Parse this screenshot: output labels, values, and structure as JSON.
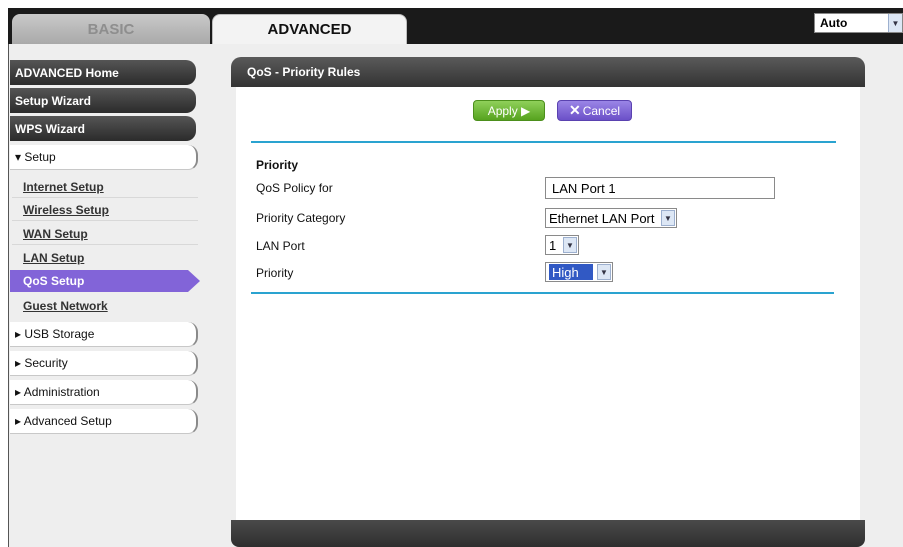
{
  "tabs": {
    "basic": "BASIC",
    "advanced": "ADVANCED"
  },
  "language_select": {
    "value": "Auto"
  },
  "sidebar": {
    "advanced_home": "ADVANCED Home",
    "setup_wizard": "Setup Wizard",
    "wps_wizard": "WPS Wizard",
    "setup": "▾ Setup",
    "setup_items": [
      "Internet Setup",
      "Wireless Setup",
      "WAN Setup",
      "LAN Setup",
      "QoS Setup",
      "Guest Network"
    ],
    "usb_storage": "▸ USB Storage",
    "security": "▸ Security",
    "administration": "▸ Administration",
    "advanced_setup": "▸ Advanced Setup"
  },
  "panel": {
    "title": "QoS - Priority Rules",
    "apply_label": "Apply ▶",
    "cancel_label": "Cancel",
    "section_title": "Priority",
    "fields": {
      "policy_label": "QoS Policy for",
      "policy_value": "LAN Port 1",
      "category_label": "Priority Category",
      "category_value": "Ethernet LAN Port",
      "lan_port_label": "LAN Port",
      "lan_port_value": "1",
      "priority_label": "Priority",
      "priority_value": "High"
    }
  },
  "colors": {
    "accent_blue": "#2aa3d0",
    "active_purple": "#8264d8",
    "apply_green": "#56a31f",
    "cancel_purple": "#6b50c8"
  }
}
